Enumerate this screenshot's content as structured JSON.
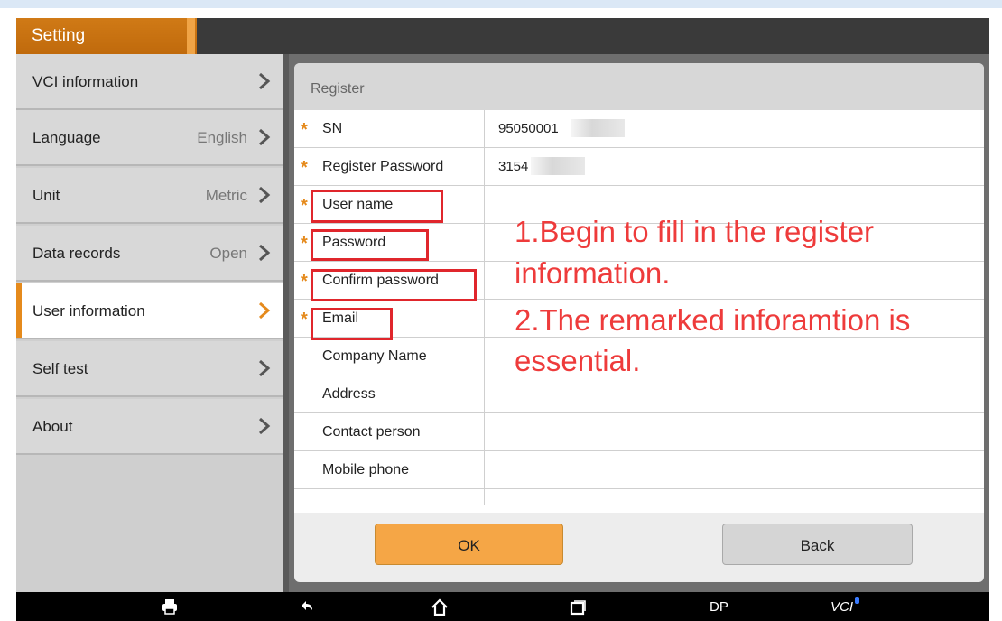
{
  "header": {
    "title": "Setting"
  },
  "menu": {
    "items": [
      {
        "label": "VCI information",
        "value": ""
      },
      {
        "label": "Language",
        "value": "English"
      },
      {
        "label": "Unit",
        "value": "Metric"
      },
      {
        "label": "Data records",
        "value": "Open"
      },
      {
        "label": "User information",
        "value": "",
        "active": true
      },
      {
        "label": "Self test",
        "value": ""
      },
      {
        "label": "About",
        "value": ""
      }
    ]
  },
  "register": {
    "title": "Register",
    "fields": [
      {
        "label": "SN",
        "value": "95050001",
        "required": true
      },
      {
        "label": "Register Password",
        "value": "3154",
        "required": true
      },
      {
        "label": "User name",
        "value": "",
        "required": true
      },
      {
        "label": "Password",
        "value": "",
        "required": true
      },
      {
        "label": "Confirm password",
        "value": "",
        "required": true
      },
      {
        "label": "Email",
        "value": "",
        "required": true
      },
      {
        "label": "Company Name",
        "value": "",
        "required": false
      },
      {
        "label": "Address",
        "value": "",
        "required": false
      },
      {
        "label": "Contact person",
        "value": "",
        "required": false
      },
      {
        "label": "Mobile phone",
        "value": "",
        "required": false
      }
    ],
    "ok_label": "OK",
    "back_label": "Back"
  },
  "annotation": {
    "line1": "1.Begin to fill in the register",
    "line2": "information.",
    "line3": "2.The remarked inforamtion is",
    "line4": "essential."
  },
  "navbar": {
    "dp_label": "DP",
    "vci_label": "VCI"
  },
  "colors": {
    "accent_orange": "#e58a1c",
    "annotation_red": "#ee3b3b",
    "ok_button": "#f5a646",
    "title_bar": "#3a3a3a"
  },
  "icons": {
    "navbar": [
      "print-icon",
      "back-icon",
      "home-icon",
      "recent-apps-icon"
    ],
    "menu": "chevron-right-icon",
    "required": "asterisk-icon"
  }
}
